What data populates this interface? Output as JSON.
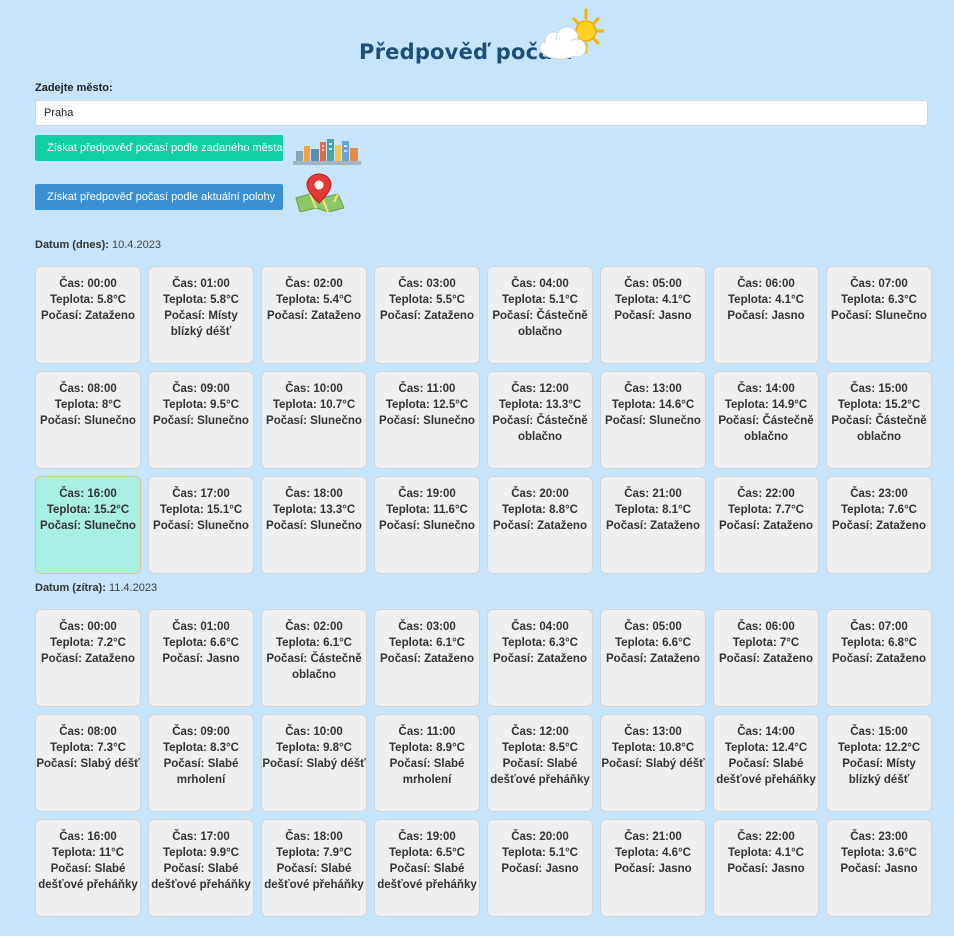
{
  "header": {
    "title": "Předpověď počasí",
    "icon": "sun-cloud-icon"
  },
  "city_form": {
    "label": "Zadejte město:",
    "value": "Praha",
    "city_button": "Získat předpověď počasí podle zadaného města",
    "location_button": "Získat předpověď počasí podle aktuální polohy"
  },
  "labels": {
    "time": "Čas:",
    "temp": "Teplota:",
    "weather": "Počasí:"
  },
  "days": [
    {
      "date_label": "Datum (dnes):",
      "date": "10.4.2023",
      "hours": [
        {
          "time": "00:00",
          "temp": "5.8°C",
          "weather": "Zataženo"
        },
        {
          "time": "01:00",
          "temp": "5.8°C",
          "weather": "Místy blízký déšť"
        },
        {
          "time": "02:00",
          "temp": "5.4°C",
          "weather": "Zataženo"
        },
        {
          "time": "03:00",
          "temp": "5.5°C",
          "weather": "Zataženo"
        },
        {
          "time": "04:00",
          "temp": "5.1°C",
          "weather": "Částečně oblačno"
        },
        {
          "time": "05:00",
          "temp": "4.1°C",
          "weather": "Jasno"
        },
        {
          "time": "06:00",
          "temp": "4.1°C",
          "weather": "Jasno"
        },
        {
          "time": "07:00",
          "temp": "6.3°C",
          "weather": "Slunečno"
        },
        {
          "time": "08:00",
          "temp": "8°C",
          "weather": "Slunečno"
        },
        {
          "time": "09:00",
          "temp": "9.5°C",
          "weather": "Slunečno"
        },
        {
          "time": "10:00",
          "temp": "10.7°C",
          "weather": "Slunečno"
        },
        {
          "time": "11:00",
          "temp": "12.5°C",
          "weather": "Slunečno"
        },
        {
          "time": "12:00",
          "temp": "13.3°C",
          "weather": "Částečně oblačno"
        },
        {
          "time": "13:00",
          "temp": "14.6°C",
          "weather": "Slunečno"
        },
        {
          "time": "14:00",
          "temp": "14.9°C",
          "weather": "Částečně oblačno"
        },
        {
          "time": "15:00",
          "temp": "15.2°C",
          "weather": "Částečně oblačno"
        },
        {
          "time": "16:00",
          "temp": "15.2°C",
          "weather": "Slunečno",
          "current": true
        },
        {
          "time": "17:00",
          "temp": "15.1°C",
          "weather": "Slunečno"
        },
        {
          "time": "18:00",
          "temp": "13.3°C",
          "weather": "Slunečno"
        },
        {
          "time": "19:00",
          "temp": "11.6°C",
          "weather": "Slunečno"
        },
        {
          "time": "20:00",
          "temp": "8.8°C",
          "weather": "Zataženo"
        },
        {
          "time": "21:00",
          "temp": "8.1°C",
          "weather": "Zataženo"
        },
        {
          "time": "22:00",
          "temp": "7.7°C",
          "weather": "Zataženo"
        },
        {
          "time": "23:00",
          "temp": "7.6°C",
          "weather": "Zataženo"
        }
      ]
    },
    {
      "date_label": "Datum (zítra):",
      "date": "11.4.2023",
      "hours": [
        {
          "time": "00:00",
          "temp": "7.2°C",
          "weather": "Zataženo"
        },
        {
          "time": "01:00",
          "temp": "6.6°C",
          "weather": "Jasno"
        },
        {
          "time": "02:00",
          "temp": "6.1°C",
          "weather": "Částečně oblačno"
        },
        {
          "time": "03:00",
          "temp": "6.1°C",
          "weather": "Zataženo"
        },
        {
          "time": "04:00",
          "temp": "6.3°C",
          "weather": "Zataženo"
        },
        {
          "time": "05:00",
          "temp": "6.6°C",
          "weather": "Zataženo"
        },
        {
          "time": "06:00",
          "temp": "7°C",
          "weather": "Zataženo"
        },
        {
          "time": "07:00",
          "temp": "6.8°C",
          "weather": "Zataženo"
        },
        {
          "time": "08:00",
          "temp": "7.3°C",
          "weather": "Slabý déšť"
        },
        {
          "time": "09:00",
          "temp": "8.3°C",
          "weather": "Slabé mrholení"
        },
        {
          "time": "10:00",
          "temp": "9.8°C",
          "weather": "Slabý déšť"
        },
        {
          "time": "11:00",
          "temp": "8.9°C",
          "weather": "Slabé mrholení"
        },
        {
          "time": "12:00",
          "temp": "8.5°C",
          "weather": "Slabé dešťové přeháňky"
        },
        {
          "time": "13:00",
          "temp": "10.8°C",
          "weather": "Slabý déšť"
        },
        {
          "time": "14:00",
          "temp": "12.4°C",
          "weather": "Slabé dešťové přeháňky"
        },
        {
          "time": "15:00",
          "temp": "12.2°C",
          "weather": "Místy blízký déšť"
        },
        {
          "time": "16:00",
          "temp": "11°C",
          "weather": "Slabé dešťové přeháňky"
        },
        {
          "time": "17:00",
          "temp": "9.9°C",
          "weather": "Slabé dešťové přeháňky"
        },
        {
          "time": "18:00",
          "temp": "7.9°C",
          "weather": "Slabé dešťové přeháňky"
        },
        {
          "time": "19:00",
          "temp": "6.5°C",
          "weather": "Slabé dešťové přeháňky"
        },
        {
          "time": "20:00",
          "temp": "5.1°C",
          "weather": "Jasno"
        },
        {
          "time": "21:00",
          "temp": "4.6°C",
          "weather": "Jasno"
        },
        {
          "time": "22:00",
          "temp": "4.1°C",
          "weather": "Jasno"
        },
        {
          "time": "23:00",
          "temp": "3.6°C",
          "weather": "Jasno"
        }
      ]
    }
  ],
  "colors": {
    "background": "#c6e4fb",
    "title": "#1d4f7a",
    "city_button": "#10cfa3",
    "location_button": "#3b8fd3",
    "card": "#efefef",
    "current_card": "#a9efe3"
  }
}
